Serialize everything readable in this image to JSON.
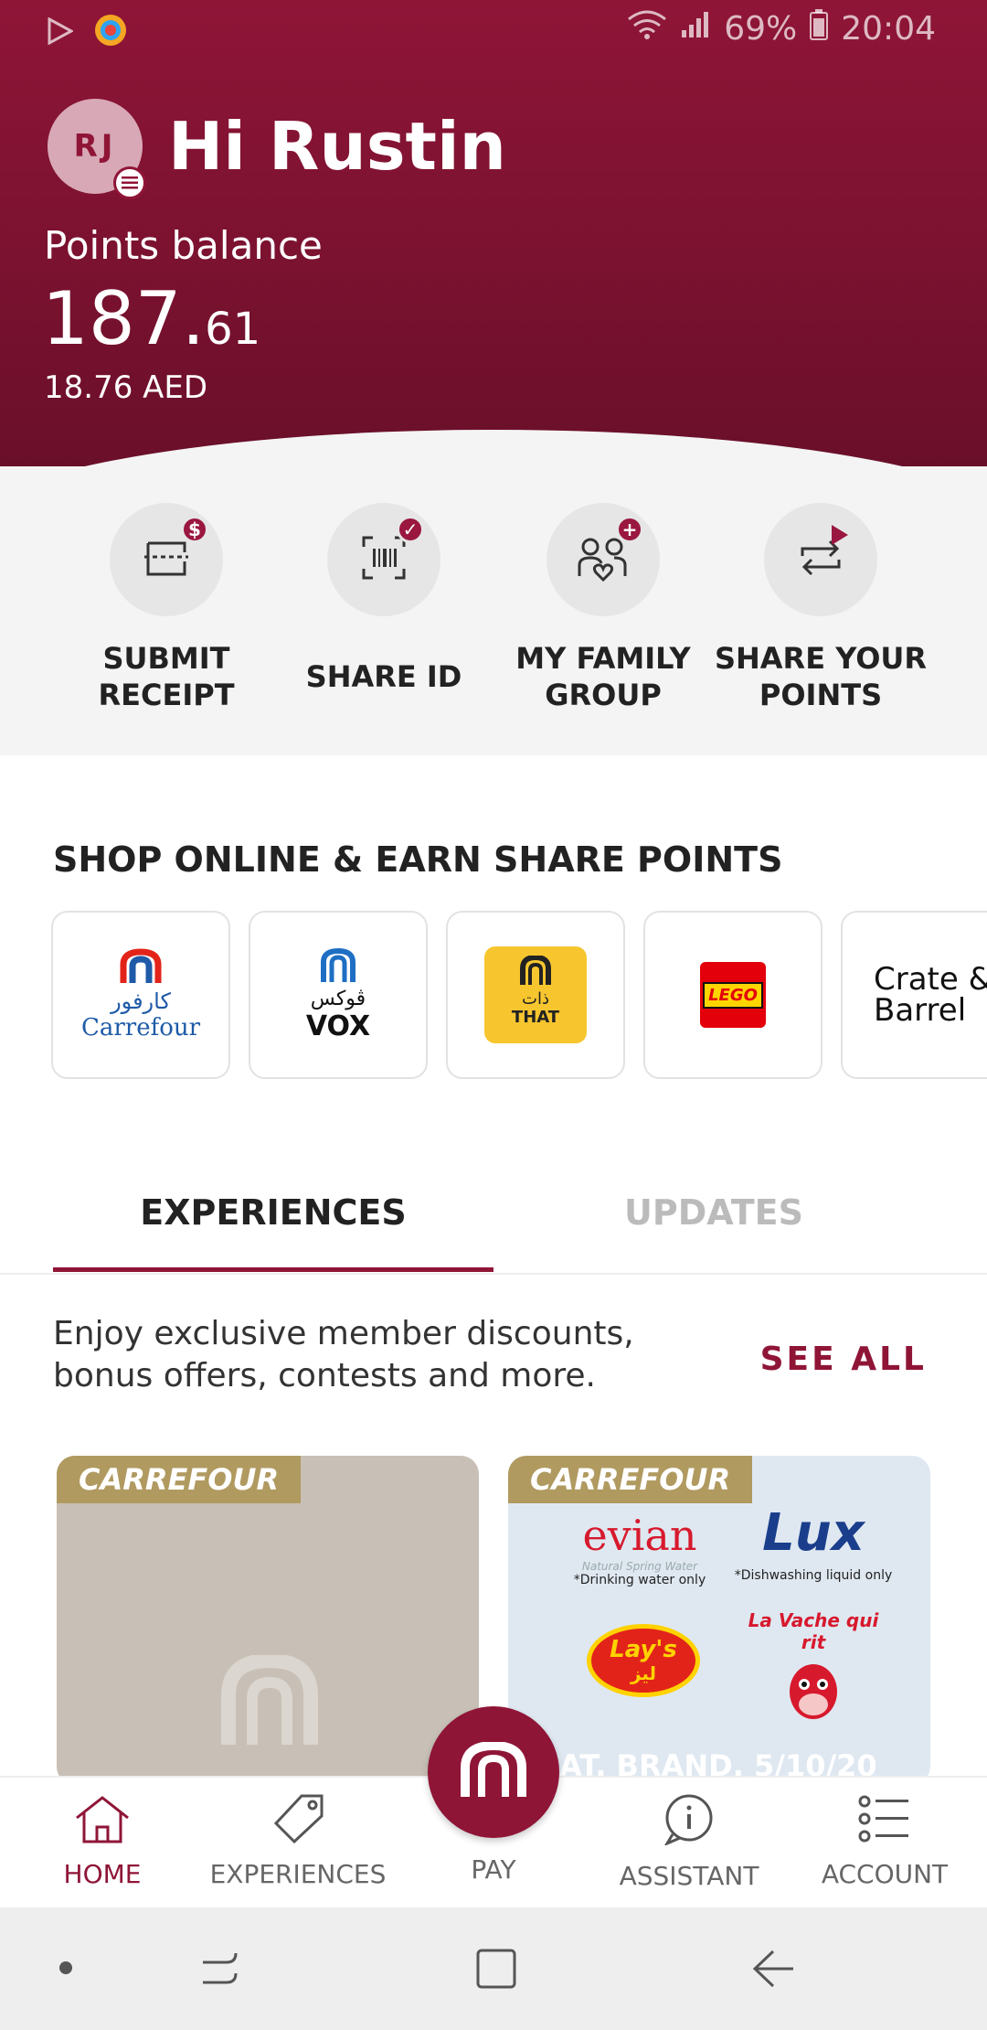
{
  "status_bar": {
    "battery": "69%",
    "time": "20:04"
  },
  "profile": {
    "initials": "RJ",
    "greeting": "Hi Rustin"
  },
  "points": {
    "label": "Points balance",
    "whole": "187.",
    "decimal": "61",
    "aed": "18.76 AED"
  },
  "quick_actions": [
    {
      "label": "SUBMIT RECEIPT",
      "icon": "receipt-icon"
    },
    {
      "label": "SHARE ID",
      "icon": "barcode-icon"
    },
    {
      "label": "MY FAMILY GROUP",
      "icon": "family-icon"
    },
    {
      "label": "SHARE YOUR POINTS",
      "icon": "transfer-icon"
    }
  ],
  "shop": {
    "title": "SHOP ONLINE & EARN SHARE POINTS",
    "brands": [
      {
        "name": "Carrefour",
        "arabic": "كارفور"
      },
      {
        "name": "VOX",
        "arabic": "ڤوكس"
      },
      {
        "name": "THAT",
        "arabic": "ذات"
      },
      {
        "name": "LEGO"
      },
      {
        "name": "Crate & Barrel"
      }
    ]
  },
  "tabs": {
    "experiences": "EXPERIENCES",
    "updates": "UPDATES"
  },
  "experiences": {
    "description": "Enjoy exclusive member discounts, bonus offers, contests and more.",
    "see_all": "SEE ALL",
    "cards": [
      {
        "tag": "CARREFOUR"
      },
      {
        "tag": "CARREFOUR",
        "caption": "AT. BRAND. 5/10/20",
        "products": [
          "evian",
          "Natural Spring Water",
          "*Drinking water only",
          "Lux",
          "*Dishwashing liquid only",
          "Lay's",
          "ليز",
          "La Vache qui rit"
        ]
      }
    ]
  },
  "bottom_nav": {
    "home": "HOME",
    "experiences": "EXPERIENCES",
    "pay": "PAY",
    "assistant": "ASSISTANT",
    "account": "ACCOUNT"
  },
  "colors": {
    "brand": "#8f1537",
    "gold": "#b09a60"
  }
}
